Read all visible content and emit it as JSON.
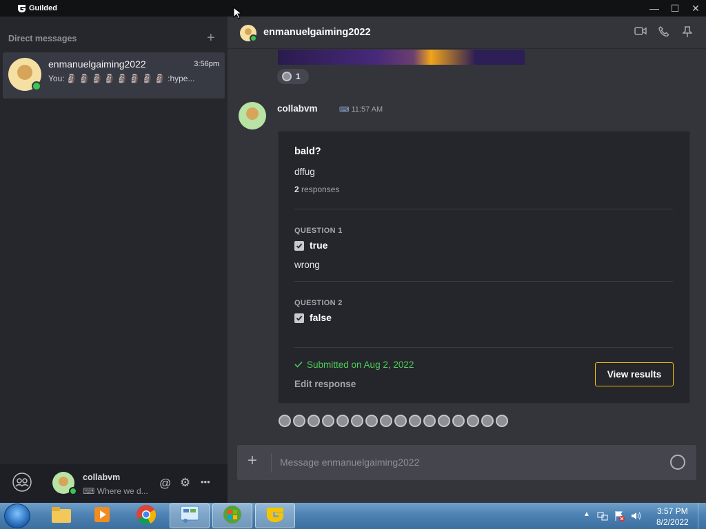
{
  "window": {
    "app_name": "Guilded",
    "controls": {
      "minimize": "—",
      "maximize": "☐",
      "close": "✕"
    }
  },
  "sidebar": {
    "header": "Direct messages",
    "add_icon": "+",
    "dm": {
      "name": "enmanuelgaiming2022",
      "time": "3:56pm",
      "preview": "You: 🗿 🗿 🗿 🗿 🗿 🗿 🗿 🗿 :hype..."
    },
    "user": {
      "name": "collabvm",
      "status": "⌨ Where we d...",
      "mention_icon": "@",
      "settings_icon": "⚙",
      "more_icon": "•••"
    }
  },
  "chat": {
    "title": "enmanuelgaiming2022",
    "reaction_count": "1",
    "message": {
      "author": "collabvm",
      "time": "11:57 AM",
      "form": {
        "title": "bald?",
        "description": "dffug",
        "response_count": "2",
        "response_label": " responses",
        "questions": [
          {
            "label": "QUESTION 1",
            "answer": "true",
            "extra": "wrong"
          },
          {
            "label": "QUESTION 2",
            "answer": "false",
            "extra": ""
          }
        ],
        "submitted": "Submitted on Aug 2, 2022",
        "edit": "Edit response",
        "view_results": "View results"
      }
    },
    "composer_placeholder": "Message enmanuelgaiming2022"
  },
  "taskbar": {
    "time": "3:57 PM",
    "date": "8/2/2022"
  },
  "colors": {
    "accent": "#f5c400",
    "online": "#3cc551",
    "submitted": "#4ecb5a"
  }
}
